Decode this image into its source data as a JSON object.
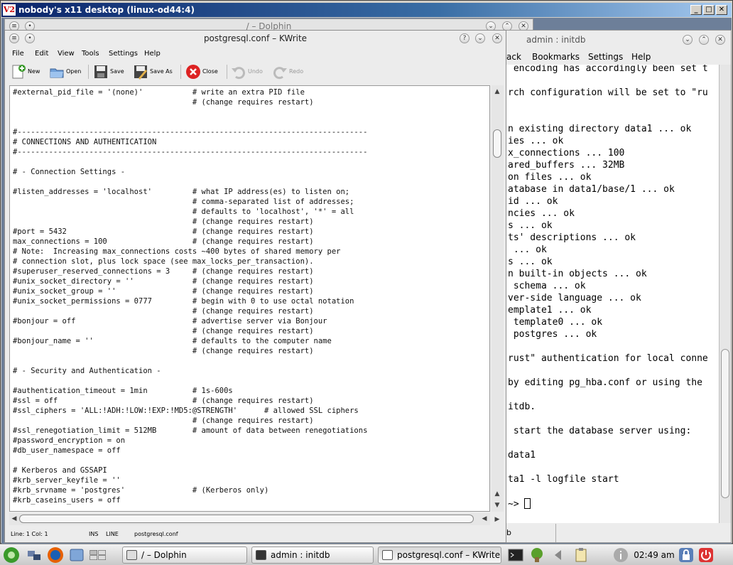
{
  "x11": {
    "title": "nobody's x11 desktop (linux-od44:4)",
    "logo": "V2"
  },
  "dolphin": {
    "title": "/ – Dolphin"
  },
  "terminal": {
    "title": "admin : initdb",
    "menu": [
      "ack",
      "Bookmarks",
      "Settings",
      "Help"
    ],
    "lines": [
      " encoding has accordingly been set t",
      "",
      "rch configuration will be set to \"ru",
      "",
      "",
      "n existing directory data1 ... ok",
      "ies ... ok",
      "x_connections ... 100",
      "ared_buffers ... 32MB",
      "on files ... ok",
      "atabase in data1/base/1 ... ok",
      "id ... ok",
      "ncies ... ok",
      "s ... ok",
      "ts' descriptions ... ok",
      " ... ok",
      "s ... ok",
      "n built-in objects ... ok",
      " schema ... ok",
      "ver-side language ... ok",
      "emplate1 ... ok",
      " template0 ... ok",
      " postgres ... ok",
      "",
      "rust\" authentication for local conne",
      "",
      "by editing pg_hba.conf or using the",
      "",
      "itdb.",
      "",
      " start the database server using:",
      "",
      "data1",
      "",
      "ta1 -l logfile start",
      ""
    ],
    "prompt": "~> ",
    "tab_label": "b"
  },
  "kwrite": {
    "title": "postgresql.conf – KWrite",
    "menu": [
      "File",
      "Edit",
      "View",
      "Tools",
      "Settings",
      "Help"
    ],
    "toolbar": {
      "new": "New",
      "open": "Open",
      "save": "Save",
      "save_as": "Save As",
      "close": "Close",
      "undo": "Undo",
      "redo": "Redo"
    },
    "lines": [
      "#external_pid_file = '(none)'           # write an extra PID file",
      "                                        # (change requires restart)",
      "",
      "",
      "#------------------------------------------------------------------------------",
      "# CONNECTIONS AND AUTHENTICATION",
      "#------------------------------------------------------------------------------",
      "",
      "# - Connection Settings -",
      "",
      "#listen_addresses = 'localhost'         # what IP address(es) to listen on;",
      "                                        # comma-separated list of addresses;",
      "                                        # defaults to 'localhost', '*' = all",
      "                                        # (change requires restart)",
      "#port = 5432                            # (change requires restart)",
      "max_connections = 100                   # (change requires restart)",
      "# Note:  Increasing max_connections costs ~400 bytes of shared memory per",
      "# connection slot, plus lock space (see max_locks_per_transaction).",
      "#superuser_reserved_connections = 3     # (change requires restart)",
      "#unix_socket_directory = ''             # (change requires restart)",
      "#unix_socket_group = ''                 # (change requires restart)",
      "#unix_socket_permissions = 0777         # begin with 0 to use octal notation",
      "                                        # (change requires restart)",
      "#bonjour = off                          # advertise server via Bonjour",
      "                                        # (change requires restart)",
      "#bonjour_name = ''                      # defaults to the computer name",
      "                                        # (change requires restart)",
      "",
      "# - Security and Authentication -",
      "",
      "#authentication_timeout = 1min          # 1s-600s",
      "#ssl = off                              # (change requires restart)",
      "#ssl_ciphers = 'ALL:!ADH:!LOW:!EXP:!MD5:@STRENGTH'      # allowed SSL ciphers",
      "                                        # (change requires restart)",
      "#ssl_renegotiation_limit = 512MB        # amount of data between renegotiations",
      "#password_encryption = on",
      "#db_user_namespace = off",
      "",
      "# Kerberos and GSSAPI",
      "#krb_server_keyfile = ''",
      "#krb_srvname = 'postgres'               # (Kerberos only)",
      "#krb_caseins_users = off"
    ],
    "status": {
      "position": "Line: 1 Col: 1",
      "mode": "INS",
      "line_mode": "LINE",
      "filename": "postgresql.conf"
    }
  },
  "taskbar": {
    "tasks": [
      "/ – Dolphin",
      "admin : initdb",
      "postgresql.conf – KWrite"
    ],
    "clock": "02:49 am"
  }
}
